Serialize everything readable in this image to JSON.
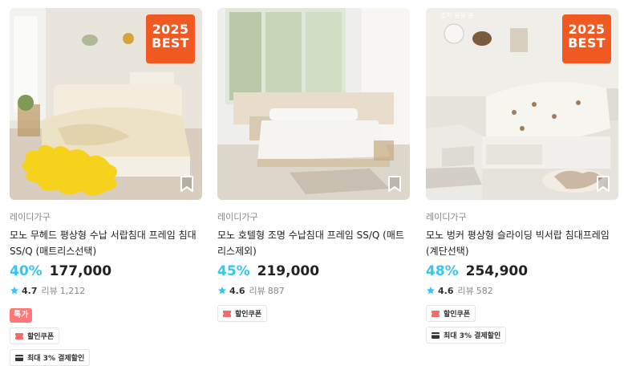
{
  "products": [
    {
      "badge_line1": "2025",
      "badge_line2": "BEST",
      "brand": "레이디가구",
      "title": "모노 무헤드 평상형 수납 서랍침대 프레임 침대 SS/Q (매트리스선택)",
      "discount": "40%",
      "price": "177,000",
      "rating": "4.7",
      "review_label": "리뷰",
      "review_count": "1,212",
      "special_tag": "특가",
      "coupon": "할인쿠폰",
      "payment": "최대 3% 결제할인"
    },
    {
      "brand": "레이디가구",
      "title": "모노 호텔형 조명 수납침대 프레임 SS/Q (매트리스제외)",
      "discount": "45%",
      "price": "219,000",
      "rating": "4.6",
      "review_label": "리뷰",
      "review_count": "887",
      "coupon": "할인쿠폰"
    },
    {
      "badge_line1": "2025",
      "badge_line2": "BEST",
      "corner_text": "출처 유유 홈",
      "brand": "레이디가구",
      "title": "모노 벙커 평상형 슬라이딩 빅서랍 침대프레임(계단선택)",
      "discount": "48%",
      "price": "254,900",
      "rating": "4.6",
      "review_label": "리뷰",
      "review_count": "582",
      "coupon": "할인쿠폰",
      "payment": "최대 3% 결제할인"
    }
  ],
  "colors": {
    "accent_discount": "#35c5f0",
    "best_badge": "#f05a22",
    "special_tag": "#ff7777",
    "coupon_icon": "#f26b6b",
    "star": "#35c5f0"
  },
  "icons": {
    "bookmark": "bookmark-icon",
    "star": "star-icon",
    "coupon": "coupon-icon",
    "card": "card-icon"
  }
}
